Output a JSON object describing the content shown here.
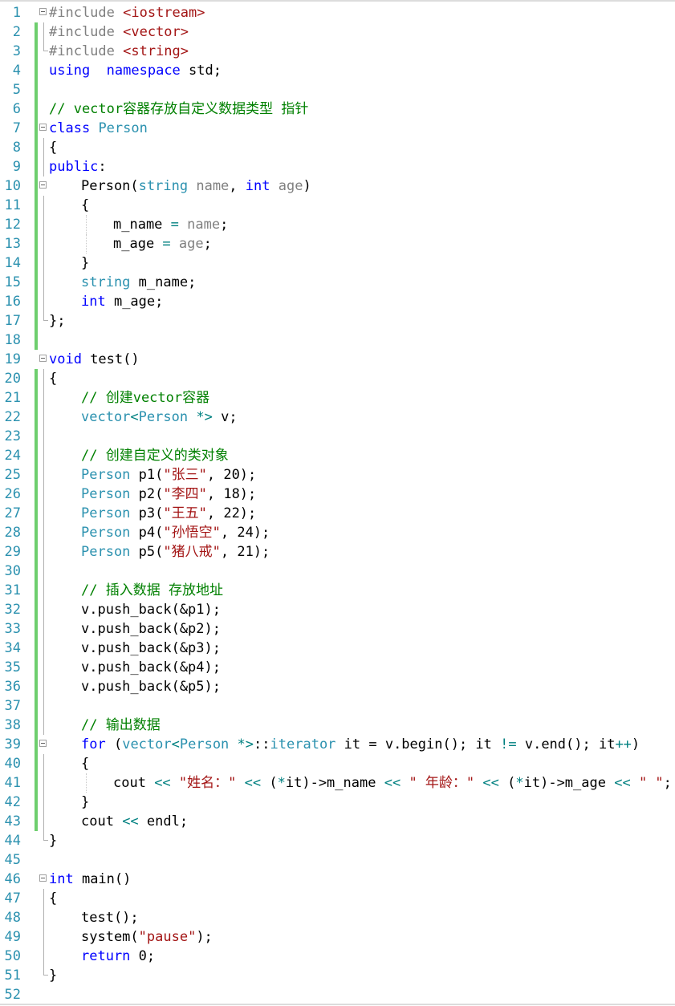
{
  "editor": {
    "language": "C++",
    "colors": {
      "line_number": "#2b91af",
      "keyword": "#0000ff",
      "type": "#2b91af",
      "comment": "#008000",
      "string": "#a31515",
      "preprocessor": "#808080",
      "change_bar": "#6ece6e"
    },
    "lines": [
      {
        "n": "1",
        "indent": 0,
        "changed": false,
        "fold": "open",
        "tokens": [
          [
            "pp",
            "#include "
          ],
          [
            "st",
            "<iostream>"
          ]
        ]
      },
      {
        "n": "2",
        "indent": 0,
        "changed": true,
        "fold": "line",
        "tokens": [
          [
            "pp",
            "#include "
          ],
          [
            "st",
            "<vector>"
          ]
        ]
      },
      {
        "n": "3",
        "indent": 0,
        "changed": true,
        "fold": "end",
        "tokens": [
          [
            "pp",
            "#include "
          ],
          [
            "st",
            "<string>"
          ]
        ]
      },
      {
        "n": "4",
        "indent": 0,
        "changed": true,
        "fold": "",
        "tokens": [
          [
            "kw",
            "using"
          ],
          [
            "",
            "  "
          ],
          [
            "kw",
            "namespace"
          ],
          [
            "",
            " std;"
          ]
        ]
      },
      {
        "n": "5",
        "indent": 0,
        "changed": true,
        "fold": "",
        "tokens": []
      },
      {
        "n": "6",
        "indent": 0,
        "changed": true,
        "fold": "",
        "tokens": [
          [
            "cm",
            "// vector容器存放自定义数据类型 指针"
          ]
        ]
      },
      {
        "n": "7",
        "indent": 0,
        "changed": true,
        "fold": "open",
        "tokens": [
          [
            "kw",
            "class"
          ],
          [
            "",
            " "
          ],
          [
            "ty",
            "Person"
          ]
        ]
      },
      {
        "n": "8",
        "indent": 0,
        "changed": true,
        "fold": "line",
        "tokens": [
          [
            "",
            "{"
          ]
        ]
      },
      {
        "n": "9",
        "indent": 0,
        "changed": true,
        "fold": "line",
        "tokens": [
          [
            "kw",
            "public"
          ],
          [
            "",
            ":"
          ]
        ]
      },
      {
        "n": "10",
        "indent": 1,
        "changed": true,
        "fold": "open",
        "tokens": [
          [
            "fn",
            "Person"
          ],
          [
            "",
            "("
          ],
          [
            "ty",
            "string"
          ],
          [
            "",
            " "
          ],
          [
            "pm",
            "name"
          ],
          [
            "",
            ", "
          ],
          [
            "kw",
            "int"
          ],
          [
            "",
            " "
          ],
          [
            "pm",
            "age"
          ],
          [
            "",
            ")"
          ]
        ]
      },
      {
        "n": "11",
        "indent": 1,
        "changed": true,
        "fold": "line",
        "tokens": [
          [
            "",
            "{"
          ]
        ]
      },
      {
        "n": "12",
        "indent": 2,
        "changed": true,
        "fold": "line",
        "tokens": [
          [
            "",
            "m_name "
          ],
          [
            "op",
            "="
          ],
          [
            "",
            " "
          ],
          [
            "pm",
            "name"
          ],
          [
            "",
            ";"
          ]
        ]
      },
      {
        "n": "13",
        "indent": 2,
        "changed": true,
        "fold": "line",
        "tokens": [
          [
            "",
            "m_age "
          ],
          [
            "op",
            "="
          ],
          [
            "",
            " "
          ],
          [
            "pm",
            "age"
          ],
          [
            "",
            ";"
          ]
        ]
      },
      {
        "n": "14",
        "indent": 1,
        "changed": true,
        "fold": "line",
        "tokens": [
          [
            "",
            "}"
          ]
        ]
      },
      {
        "n": "15",
        "indent": 1,
        "changed": true,
        "fold": "line",
        "tokens": [
          [
            "ty",
            "string"
          ],
          [
            "",
            " m_name;"
          ]
        ]
      },
      {
        "n": "16",
        "indent": 1,
        "changed": true,
        "fold": "line",
        "tokens": [
          [
            "kw",
            "int"
          ],
          [
            "",
            " m_age;"
          ]
        ]
      },
      {
        "n": "17",
        "indent": 0,
        "changed": true,
        "fold": "end",
        "tokens": [
          [
            "",
            "};"
          ]
        ]
      },
      {
        "n": "18",
        "indent": 0,
        "changed": true,
        "fold": "",
        "tokens": []
      },
      {
        "n": "19",
        "indent": 0,
        "changed": false,
        "fold": "open",
        "tokens": [
          [
            "kw",
            "void"
          ],
          [
            "",
            " test()"
          ]
        ]
      },
      {
        "n": "20",
        "indent": 0,
        "changed": true,
        "fold": "line",
        "tokens": [
          [
            "",
            "{"
          ]
        ]
      },
      {
        "n": "21",
        "indent": 1,
        "changed": true,
        "fold": "line",
        "tokens": [
          [
            "cm",
            "// 创建vector容器"
          ]
        ]
      },
      {
        "n": "22",
        "indent": 1,
        "changed": true,
        "fold": "line",
        "tokens": [
          [
            "ty",
            "vector"
          ],
          [
            "op",
            "<"
          ],
          [
            "ty",
            "Person"
          ],
          [
            "",
            " "
          ],
          [
            "op",
            "*"
          ],
          [
            "op",
            ">"
          ],
          [
            "",
            " v;"
          ]
        ]
      },
      {
        "n": "23",
        "indent": 1,
        "changed": true,
        "fold": "line",
        "tokens": []
      },
      {
        "n": "24",
        "indent": 1,
        "changed": true,
        "fold": "line",
        "tokens": [
          [
            "cm",
            "// 创建自定义的类对象"
          ]
        ]
      },
      {
        "n": "25",
        "indent": 1,
        "changed": true,
        "fold": "line",
        "tokens": [
          [
            "ty",
            "Person"
          ],
          [
            "",
            " p1("
          ],
          [
            "st",
            "\"张三\""
          ],
          [
            "",
            ", 20);"
          ]
        ]
      },
      {
        "n": "26",
        "indent": 1,
        "changed": true,
        "fold": "line",
        "tokens": [
          [
            "ty",
            "Person"
          ],
          [
            "",
            " p2("
          ],
          [
            "st",
            "\"李四\""
          ],
          [
            "",
            ", 18);"
          ]
        ]
      },
      {
        "n": "27",
        "indent": 1,
        "changed": true,
        "fold": "line",
        "tokens": [
          [
            "ty",
            "Person"
          ],
          [
            "",
            " p3("
          ],
          [
            "st",
            "\"王五\""
          ],
          [
            "",
            ", 22);"
          ]
        ]
      },
      {
        "n": "28",
        "indent": 1,
        "changed": true,
        "fold": "line",
        "tokens": [
          [
            "ty",
            "Person"
          ],
          [
            "",
            " p4("
          ],
          [
            "st",
            "\"孙悟空\""
          ],
          [
            "",
            ", 24);"
          ]
        ]
      },
      {
        "n": "29",
        "indent": 1,
        "changed": true,
        "fold": "line",
        "tokens": [
          [
            "ty",
            "Person"
          ],
          [
            "",
            " p5("
          ],
          [
            "st",
            "\"猪八戒\""
          ],
          [
            "",
            ", 21);"
          ]
        ]
      },
      {
        "n": "30",
        "indent": 1,
        "changed": true,
        "fold": "line",
        "tokens": []
      },
      {
        "n": "31",
        "indent": 1,
        "changed": true,
        "fold": "line",
        "tokens": [
          [
            "cm",
            "// 插入数据 存放地址"
          ]
        ]
      },
      {
        "n": "32",
        "indent": 1,
        "changed": true,
        "fold": "line",
        "tokens": [
          [
            "",
            "v.push_back(&p1);"
          ]
        ]
      },
      {
        "n": "33",
        "indent": 1,
        "changed": true,
        "fold": "line",
        "tokens": [
          [
            "",
            "v.push_back(&p2);"
          ]
        ]
      },
      {
        "n": "34",
        "indent": 1,
        "changed": true,
        "fold": "line",
        "tokens": [
          [
            "",
            "v.push_back(&p3);"
          ]
        ]
      },
      {
        "n": "35",
        "indent": 1,
        "changed": true,
        "fold": "line",
        "tokens": [
          [
            "",
            "v.push_back(&p4);"
          ]
        ]
      },
      {
        "n": "36",
        "indent": 1,
        "changed": true,
        "fold": "line",
        "tokens": [
          [
            "",
            "v.push_back(&p5);"
          ]
        ]
      },
      {
        "n": "37",
        "indent": 1,
        "changed": true,
        "fold": "line",
        "tokens": []
      },
      {
        "n": "38",
        "indent": 1,
        "changed": true,
        "fold": "line",
        "tokens": [
          [
            "cm",
            "// 输出数据"
          ]
        ]
      },
      {
        "n": "39",
        "indent": 1,
        "changed": true,
        "fold": "open",
        "tokens": [
          [
            "kw",
            "for"
          ],
          [
            "",
            " ("
          ],
          [
            "ty",
            "vector"
          ],
          [
            "op",
            "<"
          ],
          [
            "ty",
            "Person"
          ],
          [
            "",
            " "
          ],
          [
            "op",
            "*"
          ],
          [
            "op",
            ">"
          ],
          [
            "",
            "::"
          ],
          [
            "ty",
            "iterator"
          ],
          [
            "",
            " it = v.begin(); it "
          ],
          [
            "op",
            "!="
          ],
          [
            "",
            " v.end(); it"
          ],
          [
            "op",
            "++"
          ],
          [
            "",
            ")"
          ]
        ]
      },
      {
        "n": "40",
        "indent": 1,
        "changed": true,
        "fold": "line",
        "tokens": [
          [
            "",
            "{"
          ]
        ]
      },
      {
        "n": "41",
        "indent": 2,
        "changed": true,
        "fold": "line",
        "tokens": [
          [
            "",
            "cout "
          ],
          [
            "op",
            "<<"
          ],
          [
            "",
            " "
          ],
          [
            "st",
            "\"姓名：\""
          ],
          [
            "",
            " "
          ],
          [
            "op",
            "<<"
          ],
          [
            "",
            " ("
          ],
          [
            "op",
            "*"
          ],
          [
            "",
            "it)->m_name "
          ],
          [
            "op",
            "<<"
          ],
          [
            "",
            " "
          ],
          [
            "st",
            "\" 年龄：\""
          ],
          [
            "",
            " "
          ],
          [
            "op",
            "<<"
          ],
          [
            "",
            " ("
          ],
          [
            "op",
            "*"
          ],
          [
            "",
            "it)->m_age "
          ],
          [
            "op",
            "<<"
          ],
          [
            "",
            " "
          ],
          [
            "st",
            "\" \""
          ],
          [
            "",
            ";"
          ]
        ]
      },
      {
        "n": "42",
        "indent": 1,
        "changed": true,
        "fold": "line",
        "tokens": [
          [
            "",
            "}"
          ]
        ]
      },
      {
        "n": "43",
        "indent": 1,
        "changed": true,
        "fold": "line",
        "tokens": [
          [
            "",
            "cout "
          ],
          [
            "op",
            "<<"
          ],
          [
            "",
            " endl;"
          ]
        ]
      },
      {
        "n": "44",
        "indent": 0,
        "changed": false,
        "fold": "end",
        "tokens": [
          [
            "",
            "}"
          ]
        ]
      },
      {
        "n": "45",
        "indent": 0,
        "changed": false,
        "fold": "",
        "tokens": []
      },
      {
        "n": "46",
        "indent": 0,
        "changed": false,
        "fold": "open",
        "tokens": [
          [
            "kw",
            "int"
          ],
          [
            "",
            " main()"
          ]
        ]
      },
      {
        "n": "47",
        "indent": 0,
        "changed": false,
        "fold": "line",
        "tokens": [
          [
            "",
            "{"
          ]
        ]
      },
      {
        "n": "48",
        "indent": 1,
        "changed": false,
        "fold": "line",
        "tokens": [
          [
            "",
            "test();"
          ]
        ]
      },
      {
        "n": "49",
        "indent": 1,
        "changed": false,
        "fold": "line",
        "tokens": [
          [
            "",
            "system("
          ],
          [
            "st",
            "\"pause\""
          ],
          [
            "",
            ");"
          ]
        ]
      },
      {
        "n": "50",
        "indent": 1,
        "changed": false,
        "fold": "line",
        "tokens": [
          [
            "kw",
            "return"
          ],
          [
            "",
            " 0;"
          ]
        ]
      },
      {
        "n": "51",
        "indent": 0,
        "changed": false,
        "fold": "end",
        "tokens": [
          [
            "",
            "}"
          ]
        ]
      },
      {
        "n": "52",
        "indent": 0,
        "changed": false,
        "fold": "",
        "tokens": []
      }
    ]
  }
}
